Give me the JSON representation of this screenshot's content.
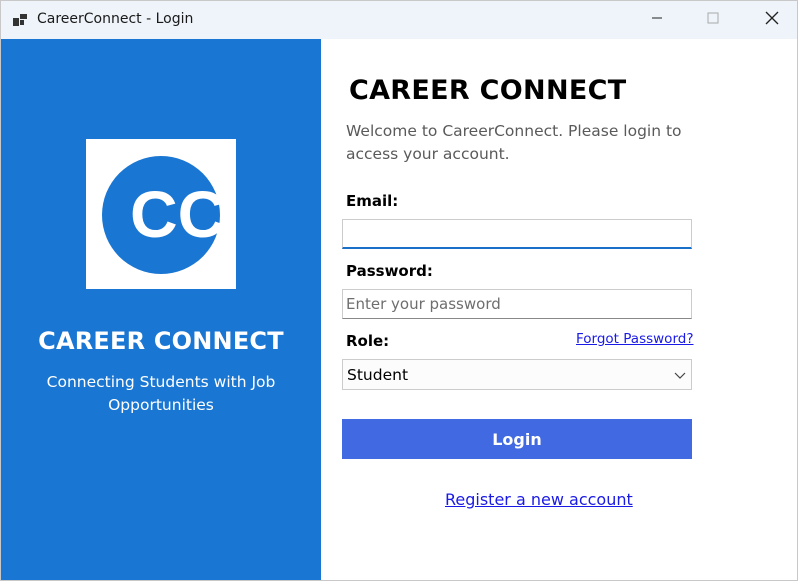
{
  "window": {
    "title": "CareerConnect - Login",
    "icons": {
      "app": "app-windows-icon",
      "minimize": "minimize-icon",
      "maximize": "maximize-icon",
      "close": "close-icon"
    }
  },
  "left_panel": {
    "logo_text": "CC",
    "brand_title": "CAREER CONNECT",
    "tagline": "Connecting Students with Job Opportunities",
    "background_color": "#1976d2"
  },
  "form": {
    "heading": "CAREER CONNECT",
    "welcome": "Welcome to CareerConnect. Please login to access your account.",
    "email": {
      "label": "Email:",
      "value": "",
      "placeholder": ""
    },
    "password": {
      "label": "Password:",
      "value": "",
      "placeholder": "Enter your password"
    },
    "role": {
      "label": "Role:",
      "selected": "Student"
    },
    "forgot_password": "Forgot Password?",
    "login_button": "Login",
    "register_link": "Register a new account",
    "button_color": "#4169e1",
    "link_color": "#1a1ae6"
  }
}
